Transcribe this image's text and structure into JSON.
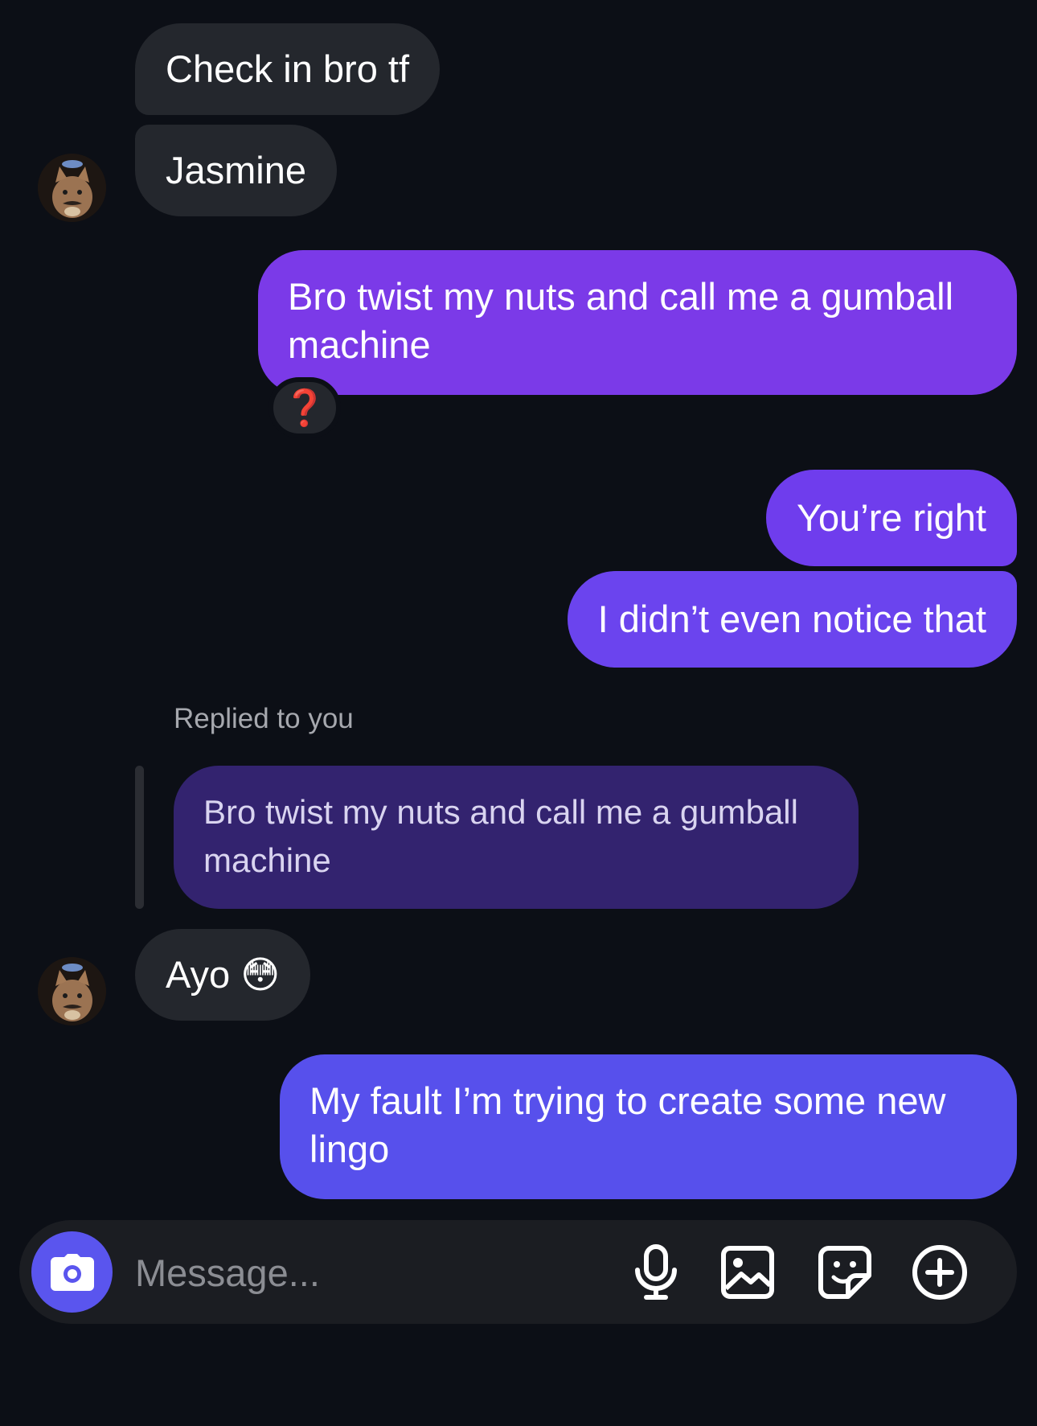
{
  "messages": {
    "incoming_1": "Check in bro tf",
    "incoming_2": "Jasmine",
    "outgoing_1": "Bro twist my nuts and call me a gumball machine",
    "outgoing_1_reaction": "❓",
    "outgoing_2": "You’re right",
    "outgoing_3": "I didn’t even notice that",
    "reply_label": "Replied to you",
    "reply_quote": "Bro twist my nuts and call me a gumball machine",
    "incoming_3": "Ayo 😳",
    "outgoing_4": "My fault I’m trying to create some new lingo"
  },
  "composer": {
    "placeholder": "Message...",
    "icons": [
      "camera-icon",
      "microphone-icon",
      "gallery-icon",
      "sticker-icon",
      "plus-icon"
    ]
  },
  "colors": {
    "background": "#0c0f16",
    "incoming_bubble": "#24272d",
    "outgoing_bubble_top": "#7b3ae8",
    "outgoing_bubble_bottom": "#5750ec",
    "reply_bubble": "#33236f",
    "camera_button": "#5a55ee"
  }
}
